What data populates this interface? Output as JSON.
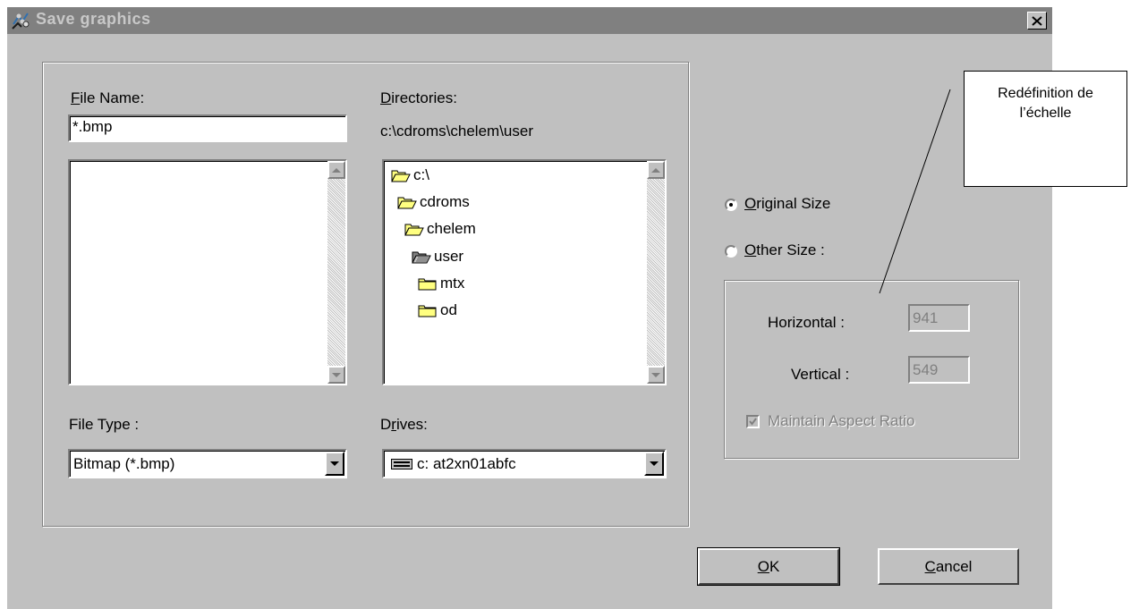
{
  "window": {
    "title": "Save graphics",
    "close_label": "✕"
  },
  "file_name": {
    "label_mnemonic": "F",
    "label_rest": "ile Name:",
    "value": "*.bmp"
  },
  "directories": {
    "label_mnemonic": "D",
    "label_rest": "irectories:",
    "path": "c:\\cdroms\\chelem\\user",
    "tree": [
      {
        "label": "c:\\",
        "icon": "open-folder-icon"
      },
      {
        "label": "cdroms",
        "icon": "open-folder-icon"
      },
      {
        "label": "chelem",
        "icon": "open-folder-icon"
      },
      {
        "label": "user",
        "icon": "open-folder-selected-icon"
      },
      {
        "label": "mtx",
        "icon": "folder-icon"
      },
      {
        "label": "od",
        "icon": "folder-icon"
      }
    ]
  },
  "file_type": {
    "label": "File Type :",
    "value": "Bitmap (*.bmp)"
  },
  "drives": {
    "label_prefix": "D",
    "label_mnemonic": "r",
    "label_rest": "ives:",
    "value": "c: at2xn01abfc",
    "icon": "drive-icon"
  },
  "size_options": {
    "original": {
      "label_prefix": "",
      "mnemonic": "O",
      "rest": "riginal Size",
      "selected": true
    },
    "other": {
      "label_prefix": "",
      "mnemonic": "O",
      "rest": "ther Size :",
      "selected": false
    }
  },
  "size_fields": {
    "horizontal_label": "Horizontal :",
    "horizontal_value": "941",
    "vertical_label": "Vertical :",
    "vertical_value": "549",
    "aspect_label": "Maintain Aspect Ratio",
    "aspect_checked": true
  },
  "buttons": {
    "ok_mnemonic": "O",
    "ok_rest": "K",
    "cancel_mnemonic": "C",
    "cancel_rest": "ancel"
  },
  "annotation": {
    "line1": "Redéfinition de",
    "line2": "l’échelle"
  }
}
